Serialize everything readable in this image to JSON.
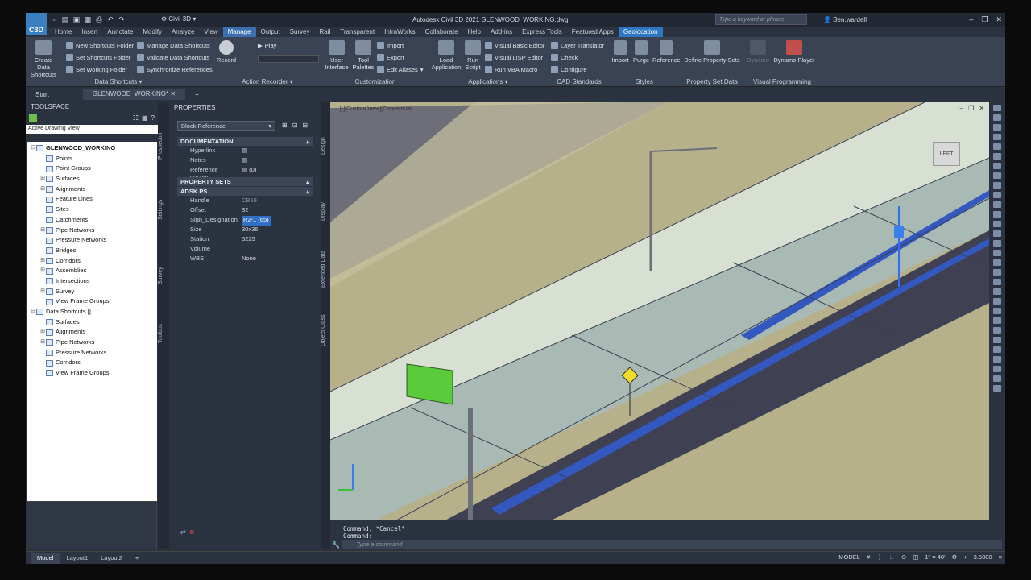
{
  "app": {
    "logo": "C3D",
    "workspace": "Civil 3D",
    "title": "Autodesk Civil 3D 2021    GLENWOOD_WORKING.dwg",
    "search_placeholder": "Type a keyword or phrase",
    "user": "Ben.wardell"
  },
  "tabs": [
    "Home",
    "Insert",
    "Annotate",
    "Modify",
    "Analyze",
    "View",
    "Manage",
    "Output",
    "Survey",
    "Rail",
    "Transparent",
    "InfraWorks",
    "Collaborate",
    "Help",
    "Add-ins",
    "Express Tools",
    "Featured Apps",
    "Geolocation"
  ],
  "ribbon": {
    "data_shortcuts": {
      "big": "Create Data Shortcuts",
      "items": [
        "New Shortcuts Folder",
        "Set Shortcuts Folder",
        "Set Working Folder",
        "Manage Data Shortcuts",
        "Validate Data Shortcuts",
        "Synchronize References"
      ],
      "label": "Data Shortcuts"
    },
    "action_recorder": {
      "record": "Record",
      "play": "Play",
      "label": "Action Recorder"
    },
    "customization": {
      "user_interface": "User Interface",
      "tool_palettes": "Tool Palettes",
      "items": [
        "Import",
        "Export",
        "Edit Aliases"
      ],
      "label": "Customization"
    },
    "applications": {
      "load": "Load Application",
      "run": "Run Script",
      "items": [
        "Visual Basic Editor",
        "Visual LISP Editor",
        "Run VBA Macro"
      ],
      "label": "Applications"
    },
    "cad_standards": {
      "items": [
        "Layer Translator",
        "Check",
        "Configure"
      ],
      "label": "CAD Standards"
    },
    "styles": {
      "items": [
        "Import",
        "Purge",
        "Reference"
      ],
      "label": "Styles"
    },
    "psd": {
      "define": "Define Property Sets",
      "label": "Property Set Data"
    },
    "vp": {
      "dynamo": "Dynamo",
      "player": "Dynamo Player",
      "label": "Visual Programming"
    }
  },
  "doc_tabs": [
    "Start",
    "GLENWOOD_WORKING*"
  ],
  "toolspace": {
    "title": "TOOLSPACE",
    "view": "Active Drawing View",
    "tree": [
      {
        "label": "GLENWOOD_WORKING",
        "level": 0,
        "exp": "⊟",
        "bold": true
      },
      {
        "label": "Points",
        "level": 1,
        "exp": ""
      },
      {
        "label": "Point Groups",
        "level": 1,
        "exp": ""
      },
      {
        "label": "Surfaces",
        "level": 1,
        "exp": "⊞"
      },
      {
        "label": "Alignments",
        "level": 1,
        "exp": "⊞"
      },
      {
        "label": "Feature Lines",
        "level": 1,
        "exp": ""
      },
      {
        "label": "Sites",
        "level": 1,
        "exp": ""
      },
      {
        "label": "Catchments",
        "level": 1,
        "exp": ""
      },
      {
        "label": "Pipe Networks",
        "level": 1,
        "exp": "⊞"
      },
      {
        "label": "Pressure Networks",
        "level": 1,
        "exp": ""
      },
      {
        "label": "Bridges",
        "level": 1,
        "exp": ""
      },
      {
        "label": "Corridors",
        "level": 1,
        "exp": "⊞"
      },
      {
        "label": "Assemblies",
        "level": 1,
        "exp": "⊞"
      },
      {
        "label": "Intersections",
        "level": 1,
        "exp": ""
      },
      {
        "label": "Survey",
        "level": 1,
        "exp": "⊞"
      },
      {
        "label": "View Frame Groups",
        "level": 1,
        "exp": ""
      },
      {
        "label": "Data Shortcuts []",
        "level": 0,
        "exp": "⊟"
      },
      {
        "label": "Surfaces",
        "level": 1,
        "exp": ""
      },
      {
        "label": "Alignments",
        "level": 1,
        "exp": "⊞"
      },
      {
        "label": "Pipe Networks",
        "level": 1,
        "exp": "⊞"
      },
      {
        "label": "Pressure Networks",
        "level": 1,
        "exp": ""
      },
      {
        "label": "Corridors",
        "level": 1,
        "exp": ""
      },
      {
        "label": "View Frame Groups",
        "level": 1,
        "exp": ""
      }
    ],
    "side_tabs": [
      "Prospector",
      "Settings",
      "Survey",
      "Toolbox"
    ]
  },
  "properties": {
    "title": "PROPERTIES",
    "selection": "Block Reference",
    "documentation": "DOCUMENTATION",
    "doc_rows": [
      {
        "k": "Hyperlink",
        "v": ""
      },
      {
        "k": "Notes",
        "v": ""
      },
      {
        "k": "Reference docum...",
        "v": "(0)"
      }
    ],
    "property_sets": "PROPERTY SETS",
    "adsk": "ADSK PS",
    "ps_rows": [
      {
        "k": "Handle",
        "v": "CB59",
        "dim": true
      },
      {
        "k": "Offset",
        "v": "32"
      },
      {
        "k": "Sign_Designation",
        "v": "R2-1 (65)",
        "sel": true
      },
      {
        "k": "Size",
        "v": "30x36"
      },
      {
        "k": "Station",
        "v": "5225"
      },
      {
        "k": "Volume",
        "v": "",
        "dim": true
      },
      {
        "k": "WBS",
        "v": "None"
      }
    ],
    "side_tabs": [
      "Design",
      "Display",
      "Extended Data",
      "Object Class"
    ]
  },
  "viewport": {
    "label": "[-][Custom View][Conceptual]",
    "cube": "LEFT"
  },
  "command": {
    "lines": [
      "Command: *Cancel*",
      "Command:"
    ],
    "placeholder": "Type a command"
  },
  "status": {
    "tabs": [
      "Model",
      "Layout1",
      "Layout2"
    ],
    "model": "MODEL",
    "scale": "1\" = 40'",
    "value": "3.5000"
  }
}
